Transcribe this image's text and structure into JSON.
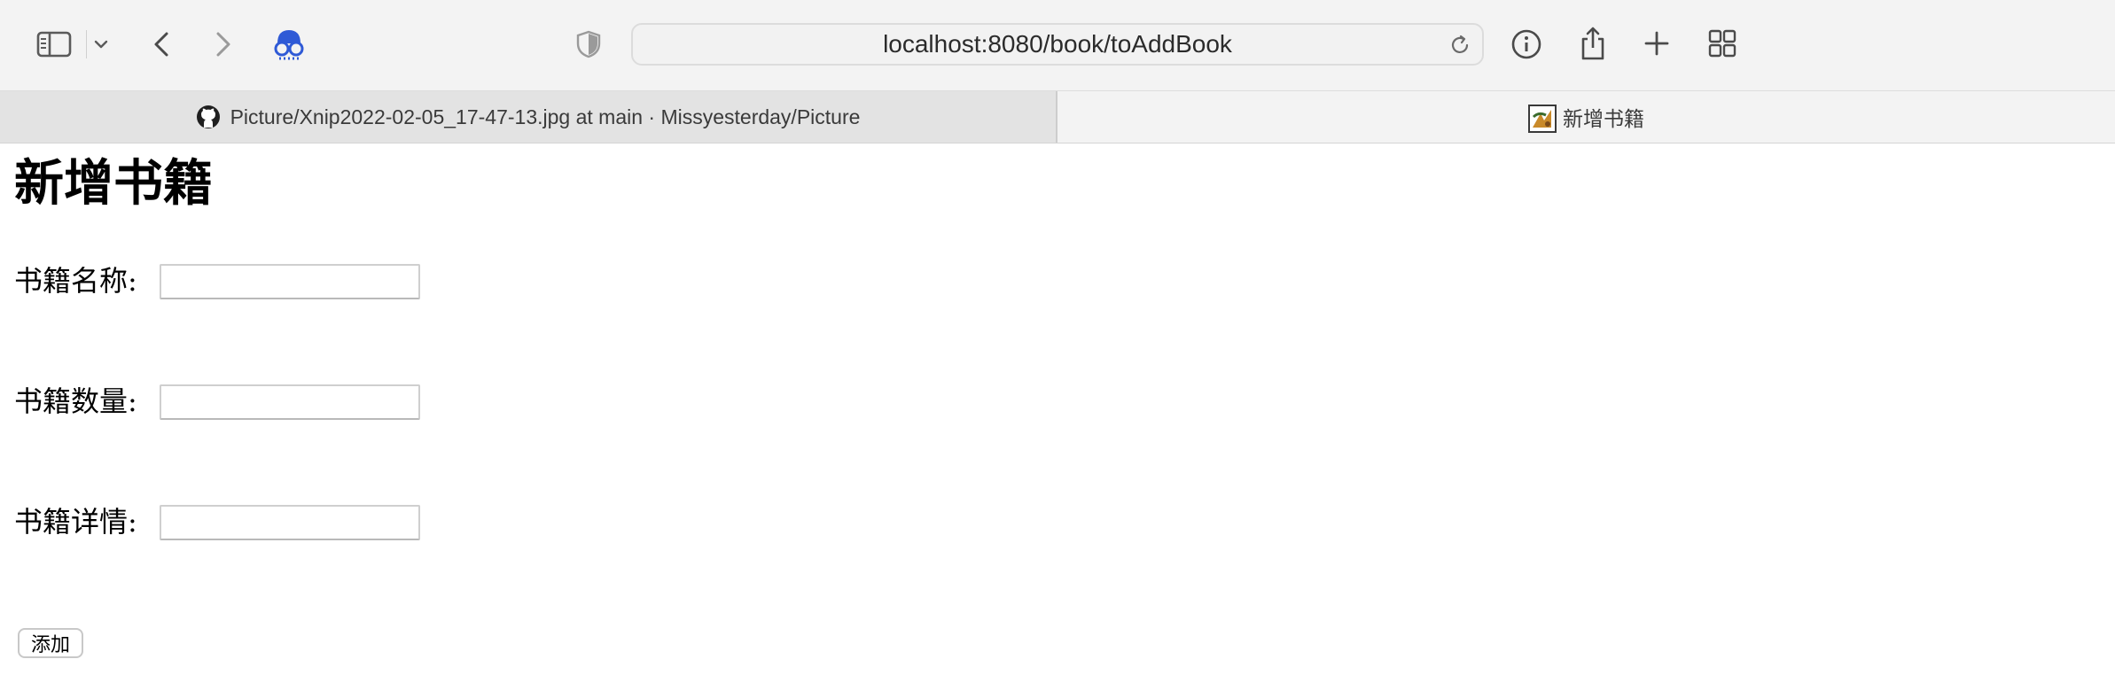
{
  "browser": {
    "url": "localhost:8080/book/toAddBook",
    "toolbar_icons": [
      "sidebar-icon",
      "chevron-down-icon",
      "back-icon",
      "forward-icon",
      "extension-icon",
      "privacy-shield-icon",
      "reload-icon",
      "info-icon",
      "share-icon",
      "new-tab-icon",
      "tab-overview-icon"
    ],
    "accent_color": "#2f5ad6"
  },
  "tabs": [
    {
      "title": "Picture/Xnip2022-02-05_17-47-13.jpg at main · Missyesterday/Picture",
      "favicon": "github-icon",
      "active": false
    },
    {
      "title": "新增书籍",
      "favicon": "page-favicon",
      "active": true
    }
  ],
  "page": {
    "heading": "新增书籍",
    "fields": [
      {
        "label": "书籍名称:",
        "value": "",
        "placeholder": ""
      },
      {
        "label": "书籍数量:",
        "value": "",
        "placeholder": ""
      },
      {
        "label": "书籍详情:",
        "value": "",
        "placeholder": ""
      }
    ],
    "submit_label": "添加"
  }
}
